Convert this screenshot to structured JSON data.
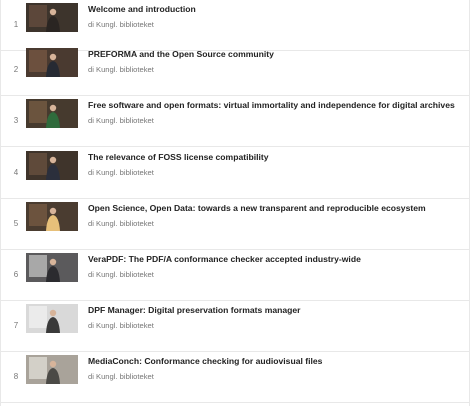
{
  "playlist": {
    "items": [
      {
        "index": "1",
        "title": "Welcome and introduction",
        "channel": "di Kungl. biblioteket",
        "thumbnail_icon": "speaker-podium-thumbnail",
        "colors": {
          "bg": "#3d342c",
          "accent": "#6a5040",
          "figure": "#2a2522"
        }
      },
      {
        "index": "2",
        "title": "PREFORMA and the Open Source community",
        "channel": "di Kungl. biblioteket",
        "thumbnail_icon": "speaker-standing-thumbnail",
        "colors": {
          "bg": "#4a3a30",
          "accent": "#7a5a44",
          "figure": "#262a33"
        }
      },
      {
        "index": "3",
        "title": "Free software and open formats: virtual immortality and independence for digital archives",
        "channel": "di Kungl. biblioteket",
        "thumbnail_icon": "speaker-green-thumbnail",
        "colors": {
          "bg": "#463a2e",
          "accent": "#7a6046",
          "figure": "#2f6b3c"
        }
      },
      {
        "index": "4",
        "title": "The relevance of FOSS license compatibility",
        "channel": "di Kungl. biblioteket",
        "thumbnail_icon": "speaker-gesturing-thumbnail",
        "colors": {
          "bg": "#3f342b",
          "accent": "#6e5442",
          "figure": "#2b2f3c"
        }
      },
      {
        "index": "5",
        "title": "Open Science, Open Data: towards a new transparent and reproducible ecosystem",
        "channel": "di Kungl. biblioteket",
        "thumbnail_icon": "speaker-woman-thumbnail",
        "colors": {
          "bg": "#4a3c30",
          "accent": "#7a5c44",
          "figure": "#e7c07a"
        }
      },
      {
        "index": "6",
        "title": "VeraPDF: The PDF/A conformance checker accepted industry-wide",
        "channel": "di Kungl. biblioteket",
        "thumbnail_icon": "speaker-screen-thumbnail",
        "colors": {
          "bg": "#5b5a5c",
          "accent": "#c9c9c9",
          "figure": "#2b2b2f"
        }
      },
      {
        "index": "7",
        "title": "DPF Manager: Digital preservation formats manager",
        "channel": "di Kungl. biblioteket",
        "thumbnail_icon": "speaker-whiteboard-thumbnail",
        "colors": {
          "bg": "#d9d9d9",
          "accent": "#f2f2f2",
          "figure": "#3a3a3a"
        }
      },
      {
        "index": "8",
        "title": "MediaConch: Conformance checking for audiovisual files",
        "channel": "di Kungl. biblioteket",
        "thumbnail_icon": "speaker-slides-thumbnail",
        "colors": {
          "bg": "#a9a39a",
          "accent": "#e5e2dc",
          "figure": "#4b4a46"
        }
      }
    ]
  }
}
